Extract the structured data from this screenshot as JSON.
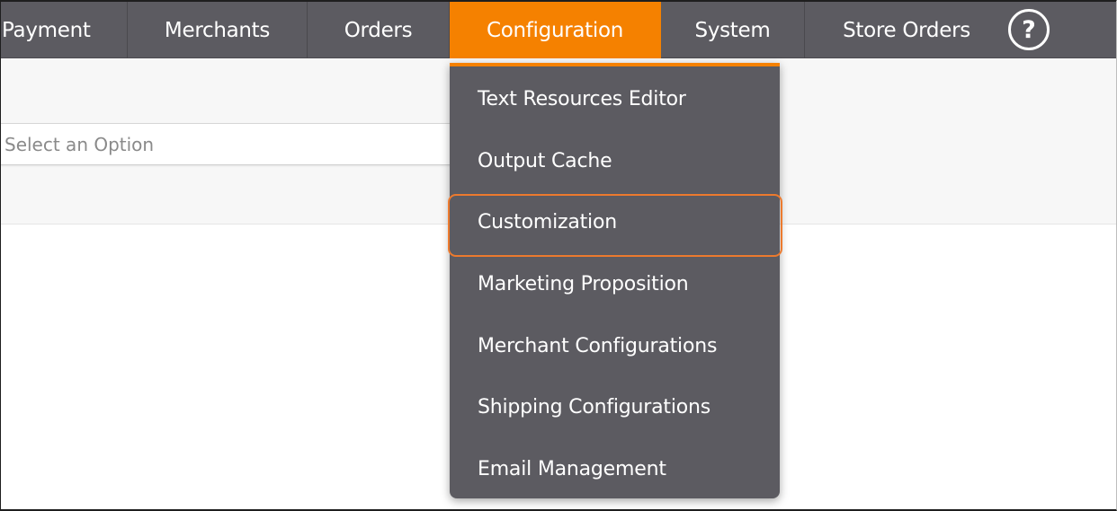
{
  "nav": {
    "items": [
      {
        "label": "Payment",
        "active": false
      },
      {
        "label": "Merchants",
        "active": false
      },
      {
        "label": "Orders",
        "active": false
      },
      {
        "label": "Configuration",
        "active": true
      },
      {
        "label": "System",
        "active": false
      },
      {
        "label": "Store Orders",
        "active": false
      }
    ],
    "help_glyph": "?",
    "help_icon": "help-circle-icon"
  },
  "filter": {
    "select_placeholder": "Select an Option"
  },
  "dropdown": {
    "items": [
      {
        "label": "Text Resources Editor"
      },
      {
        "label": "Output Cache"
      },
      {
        "label": "Customization",
        "highlighted": true
      },
      {
        "label": "Marketing Proposition"
      },
      {
        "label": "Merchant Configurations"
      },
      {
        "label": "Shipping Configurations"
      },
      {
        "label": "Email Management"
      }
    ]
  },
  "colors": {
    "nav_bg": "#5c5b61",
    "accent": "#f58100",
    "highlight_border": "#ec7a2e",
    "menu_bg": "#5c5b61"
  }
}
